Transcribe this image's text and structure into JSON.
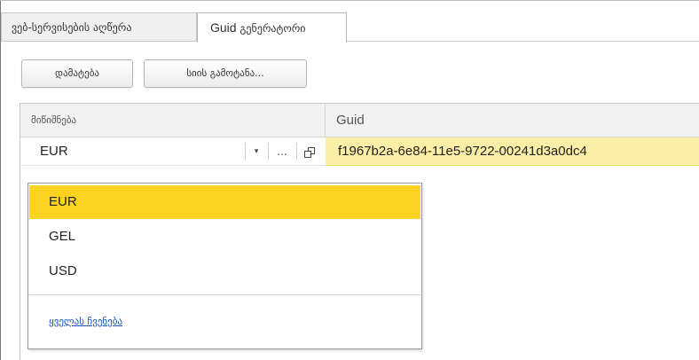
{
  "tabs": [
    {
      "label": "ვებ-სერვისების აღწერა",
      "active": false
    },
    {
      "label_latin": "Guid",
      "label_rest": " გენერატორი",
      "active": true
    }
  ],
  "toolbar": {
    "add_label": "დამატება",
    "export_label": "სიის გამოტანა..."
  },
  "table": {
    "columns": [
      "მიწიშნება",
      "Guid"
    ],
    "row": {
      "name_value": "EUR",
      "guid_value": "f1967b2a-6e84-11e5-9722-00241d3a0dc4"
    },
    "controls": {
      "dropdown_glyph": "▾",
      "more_glyph": "...",
      "open_icon": "open-form-icon"
    }
  },
  "dropdown": {
    "options": [
      "EUR",
      "GEL",
      "USD"
    ],
    "selected": "EUR",
    "show_all_label": "ყველას ჩვენება"
  },
  "colors": {
    "selected_option": "#fbd320",
    "current_cell": "#fbeea6",
    "link": "#1a53b8"
  }
}
